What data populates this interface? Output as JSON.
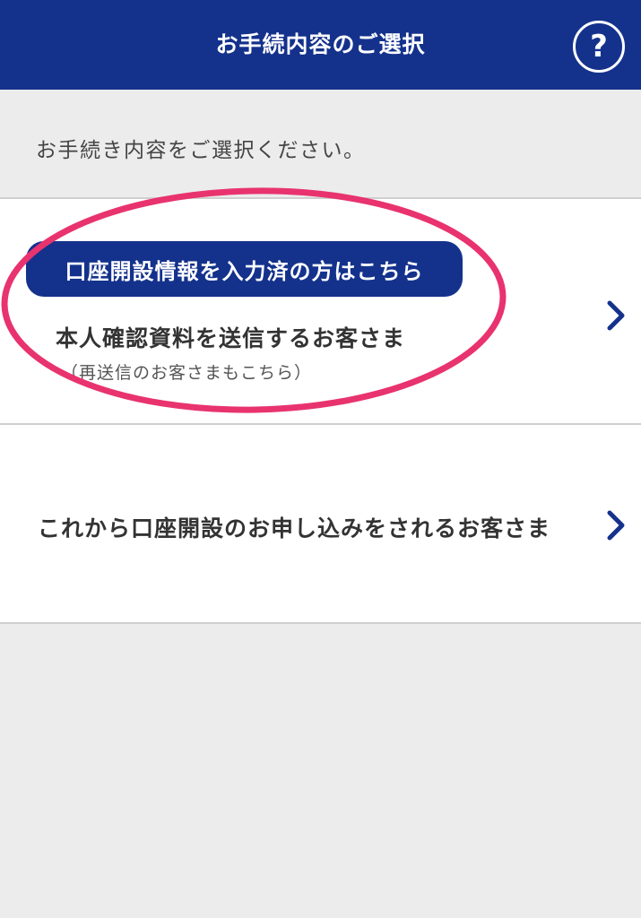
{
  "header": {
    "title": "お手続内容のご選択",
    "help_label": "?"
  },
  "instruction": "お手続き内容をご選択ください。",
  "options": [
    {
      "badge": "口座開設情報を入力済の方はこちら",
      "label": "本人確認資料を送信するお客さま",
      "sublabel": "（再送信のお客さまもこちら）",
      "icon": "chevron-right-icon"
    },
    {
      "label": "これから口座開設のお申し込みをされるお客さま",
      "icon": "chevron-right-icon"
    }
  ],
  "annotation": {
    "shape": "ellipse",
    "color": "#e8336f"
  },
  "colors": {
    "brand": "#14328c",
    "background": "#ececec",
    "card": "#ffffff",
    "highlight": "#e8336f"
  }
}
